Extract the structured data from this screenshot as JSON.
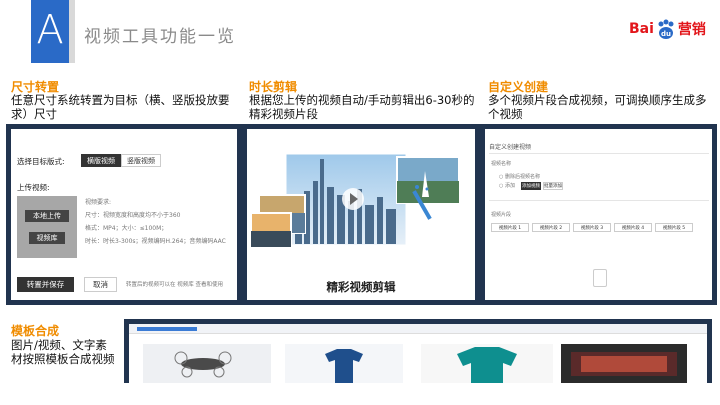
{
  "header": {
    "logo_letter": "A",
    "title": "视频工具功能一览",
    "brand": {
      "bai": "Bai",
      "du": "du",
      "suffix": "营销"
    }
  },
  "sections": {
    "resize": {
      "heading": "尺寸转置",
      "desc": "任意尺寸系统转置为目标（横、竖版投放要求）尺寸",
      "ui": {
        "select_label": "选择目标版式:",
        "options": [
          "横版视频",
          "竖版视频"
        ],
        "upload_label": "上传视频:",
        "upload_local": "本地上传",
        "upload_lib": "视频库",
        "reqs": [
          "视频要求:",
          "尺寸：视频宽度和高度均不小于360",
          "格式：MP4；大小：≤100M；",
          "时长：时长3-300s；视频编码H.264；音频编码AAC"
        ],
        "save_btn": "转置并保存",
        "cancel_btn": "取消",
        "note": "转置后的视频可以在 视频库 查看和使用"
      }
    },
    "clip": {
      "heading": "时长剪辑",
      "desc": "根据您上传的视频自动/手动剪辑出6-30秒的精彩视频片段",
      "ui": {
        "caption": "精彩视频剪辑"
      }
    },
    "custom": {
      "heading": "自定义创建",
      "desc": "多个视频片段合成视频，可调换顺序生成多个视频",
      "ui": {
        "title": "自定义创建视频",
        "row_label": "视频名称",
        "opt1": "删除后视频名称",
        "opt2": "添加",
        "btn1": "添加视频",
        "btn2": "批量添加",
        "seg_label": "视频片段",
        "segs": [
          "视频片段 1",
          "视频片段 2",
          "视频片段 3",
          "视频片段 4",
          "视频片段 5"
        ]
      }
    },
    "template": {
      "heading": "模板合成",
      "desc": "图片/视频、文字素材按照模板合成视频"
    }
  },
  "colors": {
    "accent": "#2a6ac7",
    "panel": "#21344f",
    "heading": "#f08c00",
    "brand": "#e2161b"
  }
}
